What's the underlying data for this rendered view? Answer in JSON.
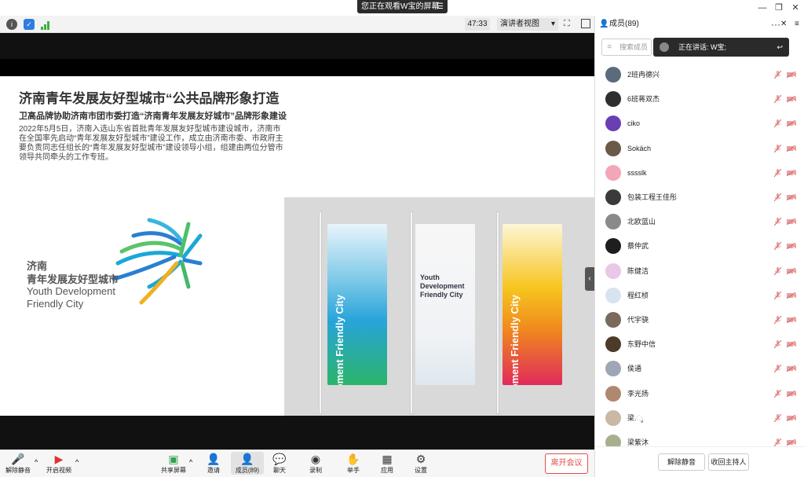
{
  "share_banner": "您正在观看W宝的屏幕",
  "toolbar": {
    "timer": "47:33",
    "view_mode": "演讲者视图"
  },
  "slide": {
    "title": "济南青年发展友好型城市“公共品牌形象打造",
    "subtitle": "卫高品牌协助济南市团市委打造“济南青年发展友好城市”品牌形象建设",
    "body": "2022年5月5日，济南入选山东省首批青年发展友好型城市建设城市，济南市在全国率先启动“青年发展友好型城市”建设工作，成立由济南市委、市政府主要负责同志任组长的“青年发展友好型城市”建设领导小组，组建由两位分管市领导共同牵头的工作专班。",
    "logo_cn1": "济南",
    "logo_cn2": "青年发展友好型城市",
    "logo_en1": "Youth Development",
    "logo_en2": "Friendly City",
    "flag1_text": "Youth Development Friendly City",
    "flag2_text": "Youth Development Friendly City",
    "flag3_text": "Youth Development Friendly City"
  },
  "bottombar": {
    "mute": "解除静音",
    "video": "开启视频",
    "share": "共享屏幕",
    "invite": "邀请",
    "members": "成员(89)",
    "chat": "聊天",
    "record": "录制",
    "raise_hand": "举手",
    "apps": "应用",
    "settings": "设置",
    "leave": "离开会议"
  },
  "panel": {
    "title": "成员(89)",
    "search_placeholder": "搜索成员",
    "speaking": "正在讲话: W宝;",
    "members": [
      {
        "name": "2班冉德兴",
        "color": "#5b6a7d"
      },
      {
        "name": "6班蒋双杰",
        "color": "#2e2e2e"
      },
      {
        "name": "ciko",
        "color": "#6a3fb5"
      },
      {
        "name": "Sokäch",
        "color": "#6b5a48"
      },
      {
        "name": "sssslk",
        "color": "#f3a6b5"
      },
      {
        "name": "包装工程王佳彤",
        "color": "#3a3a3a"
      },
      {
        "name": "北欧蓝山",
        "color": "#8a8a8a"
      },
      {
        "name": "蔡仲武",
        "color": "#1e1e1e"
      },
      {
        "name": "陈健洁",
        "color": "#e8c8e6"
      },
      {
        "name": "程红桢",
        "color": "#d9e3ef"
      },
      {
        "name": "代宇骁",
        "color": "#7a6a5c"
      },
      {
        "name": "东野中信",
        "color": "#4d3b2a"
      },
      {
        "name": "侯通",
        "color": "#9fa6b6"
      },
      {
        "name": "李光扬",
        "color": "#b08870"
      },
      {
        "name": "梁.ೃ",
        "color": "#c9b8a6"
      },
      {
        "name": "梁紫沐",
        "color": "#a7b08e"
      }
    ],
    "unmute_all": "解除静音",
    "reclaim_host": "收回主持人"
  }
}
